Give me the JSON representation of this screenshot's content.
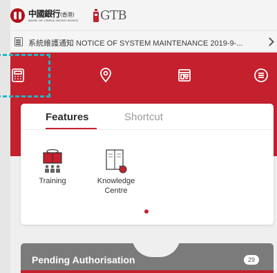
{
  "header": {
    "bank_name_cn": "中國銀行",
    "bank_name_cn_suffix": "(香港)",
    "bank_name_en": "BANK OF CHINA (HONG KONG)",
    "product_logo": "GTB"
  },
  "notice": {
    "icon": "notice-icon",
    "text": "系統維護通知 NOTICE OF SYSTEM MAINTENANCE 2019-9-...",
    "chevron_icon": "chevron-right-icon"
  },
  "toolbar": {
    "icons": [
      "calculator-icon",
      "location-pin-icon",
      "calendar-icon",
      "menu-icon"
    ],
    "highlighted_icon": "calculator-icon"
  },
  "features_card": {
    "tabs": [
      {
        "label": "Features",
        "active": true
      },
      {
        "label": "Shortcut",
        "active": false
      }
    ],
    "items": [
      {
        "label": "Training",
        "icon": "training-icon"
      },
      {
        "label": "Knowledge Centre",
        "icon": "knowledge-centre-icon"
      }
    ],
    "page_indicator": {
      "current": 1,
      "total": 1
    }
  },
  "pending": {
    "title": "Pending Authorisation",
    "count": "29"
  },
  "colors": {
    "brand_red": "#c5202d",
    "highlight": "#20b4c4",
    "pending_bg": "#7b7b7b"
  }
}
